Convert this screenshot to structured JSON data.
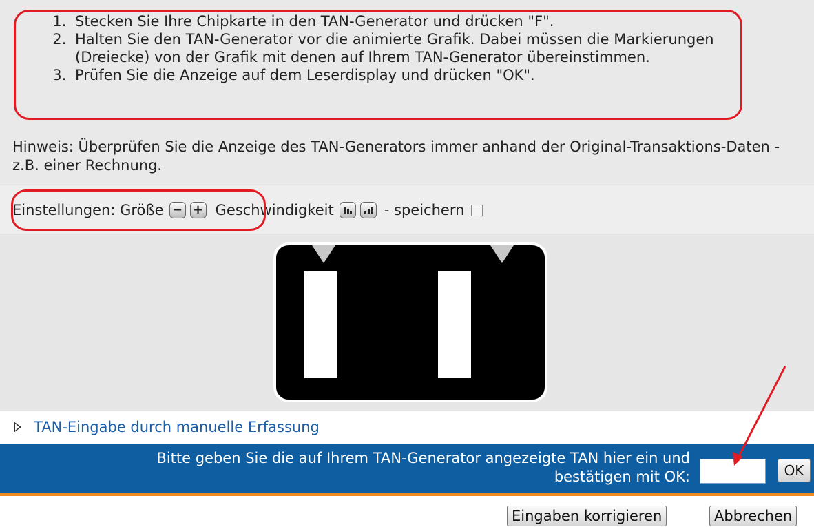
{
  "instructions": [
    "Stecken Sie Ihre Chipkarte in den TAN-Generator und drücken \"F\".",
    "Halten Sie den TAN-Generator vor die animierte Grafik. Dabei müssen die Markierungen (Dreiecke) von der Grafik mit denen auf Ihrem TAN-Generator übereinstimmen.",
    "Prüfen Sie die Anzeige auf dem Leserdisplay und drücken \"OK\"."
  ],
  "hint": "Hinweis: Überprüfen Sie die Anzeige des TAN-Generators immer anhand der Original-Transaktions-Daten - z.B. einer Rechnung.",
  "settings": {
    "label": "Einstellungen: Größe",
    "size_minus": "−",
    "size_plus": "+",
    "speed_label": "Geschwindigkeit",
    "save_label": "- speichern"
  },
  "manual_link": "TAN-Eingabe durch manuelle Erfassung",
  "tan_prompt_line1": "Bitte geben Sie die auf Ihrem TAN-Generator angezeigte TAN hier ein und",
  "tan_prompt_line2": "bestätigen mit OK:",
  "tan_input_value": "",
  "ok_label": "OK",
  "correct_label": "Eingaben korrigieren",
  "cancel_label": "Abbrechen",
  "colors": {
    "annotation_red": "#e01b24",
    "blue_bar": "#0f5ea2",
    "orange_line": "#f08a1c",
    "link": "#1c5fa8"
  }
}
